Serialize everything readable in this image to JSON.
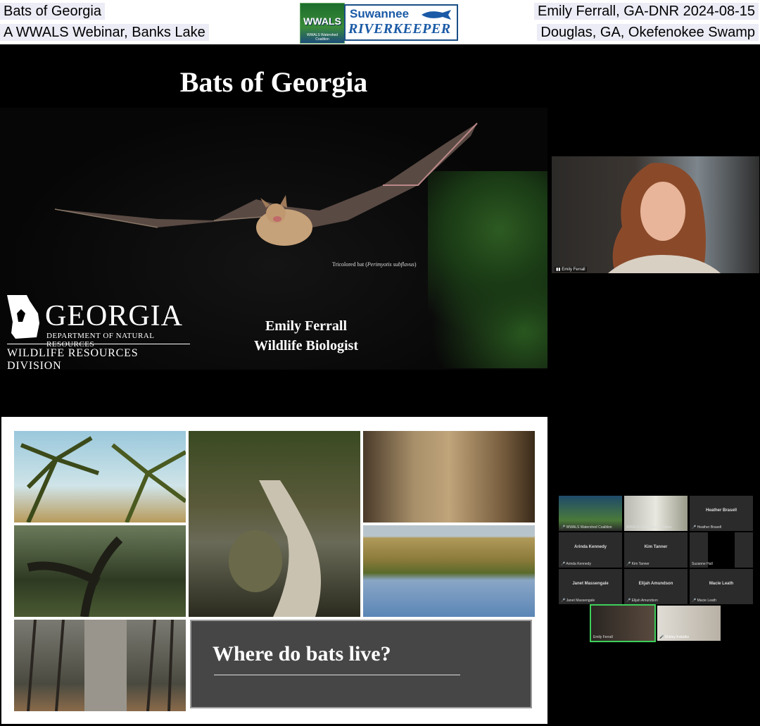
{
  "header": {
    "top_left": "Bats of Georgia",
    "sub_left": "A WWALS Webinar, Banks Lake",
    "top_right": "Emily Ferrall, GA-DNR 2024-08-15",
    "sub_right": "Douglas, GA, Okefenokee Swamp",
    "logo_wwals": "WWALS",
    "logo_wwals_sub": "WWALS Watershed Coalition",
    "logo_srk_line1": "Suwannee",
    "logo_srk_line2": "RIVERKEEPER"
  },
  "slide1": {
    "title": "Bats of Georgia",
    "photo_caption_prefix": "Tricolored bat (",
    "photo_caption_species": "Perimyotis subflavus",
    "photo_caption_suffix": ")",
    "agency_big": "GEORGIA",
    "agency_dept": "DEPARTMENT OF NATURAL RESOURCES",
    "agency_division": "WILDLIFE RESOURCES DIVISION",
    "speaker_name": "Emily Ferrall",
    "speaker_title": "Wildlife Biologist"
  },
  "speaker_video": {
    "name": "Emily Ferrall"
  },
  "slide2": {
    "question": "Where do bats live?"
  },
  "gallery": [
    {
      "tile": "WWALS Watershed Coalition",
      "kind": "video-a"
    },
    {
      "tile": "WWALS Watershed Coalition",
      "kind": "video-b"
    },
    {
      "tile": "Heather Brasell",
      "center": "Heather Brasell"
    },
    {
      "tile": "Arinda Kennedy",
      "center": "Arinda Kennedy"
    },
    {
      "tile": "Kim Tanner",
      "center": "Kim Tanner"
    },
    {
      "tile": "Suzanne Hall",
      "kind": "dark"
    },
    {
      "tile": "Janet Massengale",
      "center": "Janet Massengale"
    },
    {
      "tile": "Elijah Amundson",
      "center": "Elijah Amundson"
    },
    {
      "tile": "Macie Leath",
      "center": "Macie Leath"
    },
    {
      "tile": "Emily Ferrall",
      "kind": "video-emily"
    },
    {
      "tile": "Shirley Kokidko",
      "kind": "video-shirley"
    }
  ],
  "colors": {
    "label_bg": "#ececf6",
    "accent_green": "#3dcf5a"
  }
}
